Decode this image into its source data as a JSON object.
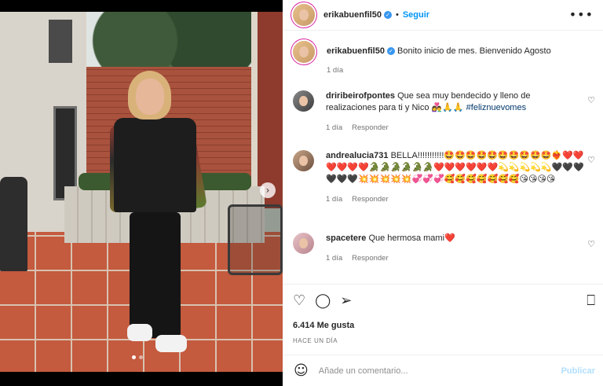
{
  "header": {
    "username": "erikabuenfil50",
    "separator": "•",
    "follow_label": "Seguir",
    "more_icon": "more-horizontal-icon"
  },
  "caption": {
    "username": "erikabuenfil50",
    "text": "Bonito inicio de mes. Bienvenido Agosto",
    "time": "1 día"
  },
  "comments": [
    {
      "username": "driribeirofpontes",
      "text": "Que sea muy bendecido y lleno de realizaciones para ti y Nico 👩‍❤️‍👨🙏🙏",
      "hashtag": "#feliznuevomes",
      "time": "1 día",
      "reply_label": "Responder"
    },
    {
      "username": "andrealucia731",
      "text": "BELLA!!!!!!!!!!!🤩🤩🤩🤩🤩🤩🤩🤩🤩🤩❤️‍🔥❤️❤️❤️❤️❤️❤️🐊🐊🐊🐊🐊🐊❤️❤️❤️❤️❤️❤️💫💫💫💫💫🖤🖤🖤🖤🖤🖤💥💥💥💥💥💞💞💞🥰🥰🥰🥰🥰🥰🥰😘😘😘😘",
      "time": "1 día",
      "reply_label": "Responder"
    },
    {
      "username": "spacetere",
      "text": "Que hermosa mami❤️",
      "time": "1 día",
      "reply_label": "Responder"
    }
  ],
  "actions": {
    "likes": "6.414 Me gusta",
    "posted": "HACE UN DÍA"
  },
  "add_comment": {
    "placeholder": "Añade un comentario...",
    "post_label": "Publicar"
  },
  "colors": {
    "accent": "#0095f6",
    "verified": "#3897f0",
    "heart": "#ed4956"
  }
}
